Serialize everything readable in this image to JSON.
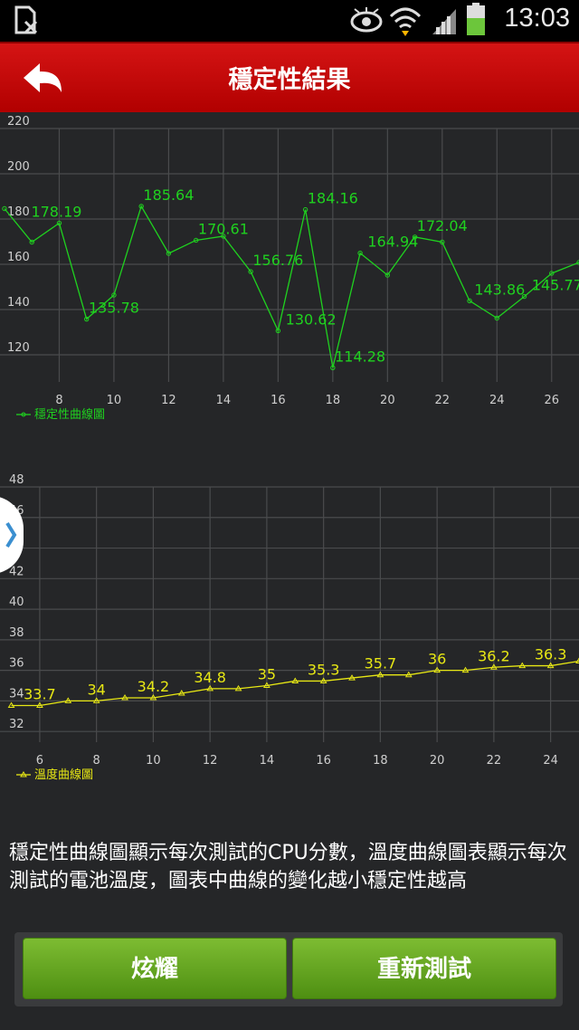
{
  "status_bar": {
    "time": "13:03"
  },
  "header": {
    "title": "穩定性結果"
  },
  "stability_chart": {
    "chart_data": {
      "type": "line",
      "legend": "穩定性曲線圖",
      "color": "#1fd21f",
      "x": [
        6,
        7,
        8,
        9,
        10,
        11,
        12,
        13,
        14,
        15,
        16,
        17,
        18,
        19,
        20,
        21,
        22,
        23,
        24,
        25,
        26,
        27
      ],
      "y": [
        184.6,
        169.8,
        178.19,
        135.78,
        146.4,
        185.64,
        164.8,
        170.61,
        172.4,
        156.76,
        130.62,
        184.16,
        114.28,
        164.94,
        155.2,
        172.04,
        169.8,
        143.86,
        136.2,
        145.77,
        156.0,
        160.8
      ],
      "point_labels": [
        {
          "x": 7.9,
          "y": 178.19,
          "text": "178.19"
        },
        {
          "x": 10,
          "y": 135.78,
          "text": "135.78"
        },
        {
          "x": 12,
          "y": 185.64,
          "text": "185.64"
        },
        {
          "x": 14,
          "y": 170.61,
          "text": "170.61"
        },
        {
          "x": 16,
          "y": 156.76,
          "text": "156.76"
        },
        {
          "x": 17.2,
          "y": 130.62,
          "text": "130.62"
        },
        {
          "x": 18,
          "y": 184.16,
          "text": "184.16"
        },
        {
          "x": 19,
          "y": 114.28,
          "text": "114.28"
        },
        {
          "x": 20.2,
          "y": 164.94,
          "text": "164.94"
        },
        {
          "x": 22,
          "y": 172.04,
          "text": "172.04"
        },
        {
          "x": 24.1,
          "y": 143.86,
          "text": "143.86"
        },
        {
          "x": 26.2,
          "y": 145.77,
          "text": "145.77"
        }
      ],
      "xticks": [
        8,
        10,
        12,
        14,
        16,
        18,
        20,
        22,
        24,
        26
      ],
      "yticks": [
        120,
        140,
        160,
        180,
        200,
        220
      ],
      "xlim": [
        6.1,
        27
      ],
      "ylim": [
        108,
        220
      ],
      "grid": true
    }
  },
  "temperature_chart": {
    "chart_data": {
      "type": "line",
      "legend": "溫度曲線圖",
      "color": "#e8e814",
      "x": [
        5,
        6,
        7,
        8,
        9,
        10,
        11,
        12,
        13,
        14,
        15,
        16,
        17,
        18,
        19,
        20,
        21,
        22,
        23,
        24,
        25
      ],
      "y": [
        33.7,
        33.7,
        34.0,
        34.0,
        34.2,
        34.2,
        34.5,
        34.8,
        34.8,
        35.0,
        35.3,
        35.3,
        35.5,
        35.7,
        35.7,
        36.0,
        36.0,
        36.2,
        36.3,
        36.3,
        36.6
      ],
      "point_labels": [
        {
          "x": 6,
          "y": 33.7,
          "text": "33.7"
        },
        {
          "x": 8,
          "y": 34.0,
          "text": "34"
        },
        {
          "x": 10,
          "y": 34.2,
          "text": "34.2"
        },
        {
          "x": 12,
          "y": 34.8,
          "text": "34.8"
        },
        {
          "x": 14,
          "y": 35.0,
          "text": "35"
        },
        {
          "x": 16,
          "y": 35.3,
          "text": "35.3"
        },
        {
          "x": 18,
          "y": 35.7,
          "text": "35.7"
        },
        {
          "x": 20,
          "y": 36.0,
          "text": "36"
        },
        {
          "x": 22,
          "y": 36.2,
          "text": "36.2"
        },
        {
          "x": 24,
          "y": 36.3,
          "text": "36.3"
        }
      ],
      "xticks": [
        6,
        8,
        10,
        12,
        14,
        16,
        18,
        20,
        22,
        24
      ],
      "yticks": [
        32,
        34,
        36,
        38,
        40,
        42,
        44,
        46,
        48
      ],
      "xlim": [
        4.6,
        25
      ],
      "ylim": [
        31.3,
        48
      ],
      "grid": true
    }
  },
  "description": "穩定性曲線圖顯示每次測試的CPU分數，溫度曲線圖表顯示每次測試的電池溫度，圖表中曲線的變化越小穩定性越高",
  "buttons": {
    "show_off": "炫耀",
    "retest": "重新測試"
  }
}
